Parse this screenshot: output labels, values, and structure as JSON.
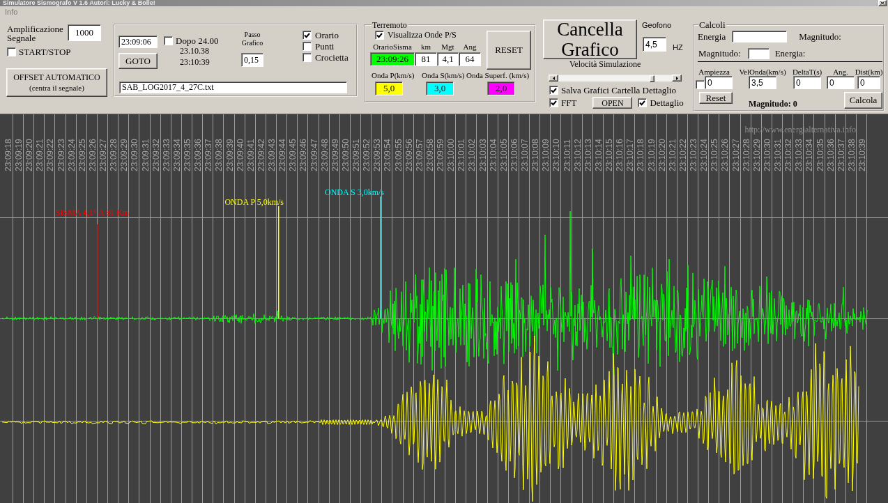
{
  "window": {
    "title": "Simulatore Sismografo V 1.6 Autori: Lucky & Bolle!"
  },
  "menu": [
    "Info"
  ],
  "amplification": {
    "label": "Amplificazione Segnale",
    "value": "1000"
  },
  "start_stop": {
    "label": "START/STOP",
    "checked": false
  },
  "offset_button": {
    "title": "OFFSET AUTOMATICO",
    "subtitle": "(centra il segnale)"
  },
  "navigation": {
    "time": "23:09:06",
    "goto_button": "GOTO",
    "after_midnight": {
      "label": "Dopo 24.00",
      "checked": false
    },
    "times": [
      "23.10.38",
      "23:10:39"
    ],
    "step": {
      "label": "Passo Grafico",
      "value": "0,15"
    },
    "options": [
      {
        "label": "Orario",
        "checked": true
      },
      {
        "label": "Punti",
        "checked": false
      },
      {
        "label": "Crocietta",
        "checked": false
      }
    ],
    "file": "SAB_LOG2017_4_27C.txt"
  },
  "earthquake": {
    "title": "Terremoto",
    "show_waves": {
      "label": "Visualizza Onde P/S",
      "checked": true
    },
    "fields": [
      {
        "label": "OrarioSisma",
        "value": "23:09:26",
        "color": "#00ff00"
      },
      {
        "label": "km",
        "value": "81",
        "color": "#ffffff"
      },
      {
        "label": "Mgt",
        "value": "4,1",
        "color": "#ffffff"
      },
      {
        "label": "Ang",
        "value": "64",
        "color": "#ffffff"
      }
    ],
    "reset_button": "RESET",
    "wave_speeds": [
      {
        "label": "Onda P(km/s)",
        "value": "5,0",
        "color": "#ffff00"
      },
      {
        "label": "Onda S(km/s)",
        "value": "3,0",
        "color": "#00ffff"
      },
      {
        "label": "Onda Superf. (km/s)",
        "value": "2,0",
        "color": "#ff00ff"
      }
    ]
  },
  "clear_button": "Cancella Grafico",
  "geophone": {
    "label": "Geofono",
    "value": "4,5",
    "unit": "HZ"
  },
  "simulation": {
    "label": "Velocità Simulazione",
    "level": 0.84
  },
  "save_charts": {
    "label": "Salva Grafici Cartella Dettaglio",
    "checked": true
  },
  "fft": {
    "label": "FFT",
    "checked": true
  },
  "open_button": "OPEN",
  "detail": {
    "label": "Dettaglio",
    "checked": true
  },
  "calculations": {
    "title": "Calcoli",
    "energy": {
      "label": "Energia",
      "result_label": "Magnitudo:"
    },
    "magnitude": {
      "label": "Magnitudo:",
      "result_label": "Energia:"
    },
    "enabled": {
      "checked": false
    },
    "columns": [
      {
        "label": "Ampiezza",
        "value": "0"
      },
      {
        "label": "VelOnda(km/s)",
        "value": "3,5"
      },
      {
        "label": "DeltaT(s)",
        "value": "0"
      },
      {
        "label": "Ang.",
        "value": "0"
      },
      {
        "label": "Dist(km)",
        "value": "0"
      }
    ],
    "reset_button": "Reset",
    "result": "Magnitudo: 0",
    "calculate_button": "Calcola"
  },
  "seismogram": {
    "website": "http://www.energialternativa.info",
    "time_labels": [
      "23:09:18",
      "23:09:19",
      "23:09:20",
      "23:09:21",
      "23:09:22",
      "23:09:23",
      "23:09:24",
      "23:09:25",
      "23:09:26",
      "23:09:27",
      "23:09:28",
      "23:09:29",
      "23:09:30",
      "23:09:31",
      "23:09:32",
      "23:09:33",
      "23:09:34",
      "23:09:35",
      "23:09:36",
      "23:09:37",
      "23:09:38",
      "23:09:39",
      "23:09:40",
      "23:09:41",
      "23:09:42",
      "23:09:43",
      "23:09:44",
      "23:09:45",
      "23:09:46",
      "23:09:47",
      "23:09:48",
      "23:09:49",
      "23:09:50",
      "23:09:51",
      "23:09:52",
      "23:09:53",
      "23:09:54",
      "23:09:55",
      "23:09:56",
      "23:09:57",
      "23:09:58",
      "23:09:59",
      "23:10:00",
      "23:10:01",
      "23:10:02",
      "23:10:03",
      "23:10:04",
      "23:10:05",
      "23:10:06",
      "23:10:07",
      "23:10:08",
      "23:10:09",
      "23:10:10",
      "23:10:11",
      "23:10:12",
      "23:10:13",
      "23:10:14",
      "23:10:15",
      "23:10:16",
      "23:10:17",
      "23:10:18",
      "23:10:19",
      "23:10:20",
      "23:10:21",
      "23:10:22",
      "23:10:23",
      "23:10:24",
      "23:10:25",
      "23:10:26",
      "23:10:27",
      "23:10:28",
      "23:10:29",
      "23:10:30",
      "23:10:31",
      "23:10:32",
      "23:10:33",
      "23:10:34",
      "23:10:35",
      "23:10:36",
      "23:10:37",
      "23:10:38",
      "23:10:39"
    ],
    "markers": [
      {
        "label": "SISMA 4,1° A 81 Km",
        "color": "#ff0000"
      },
      {
        "label": "ONDA P 5,0km/s",
        "color": "#ffff00"
      },
      {
        "label": "ONDA S 3,0km/s",
        "color": "#00ffff"
      }
    ],
    "traces": [
      {
        "color": "#00ff00"
      },
      {
        "color": "#ffff00"
      }
    ]
  }
}
